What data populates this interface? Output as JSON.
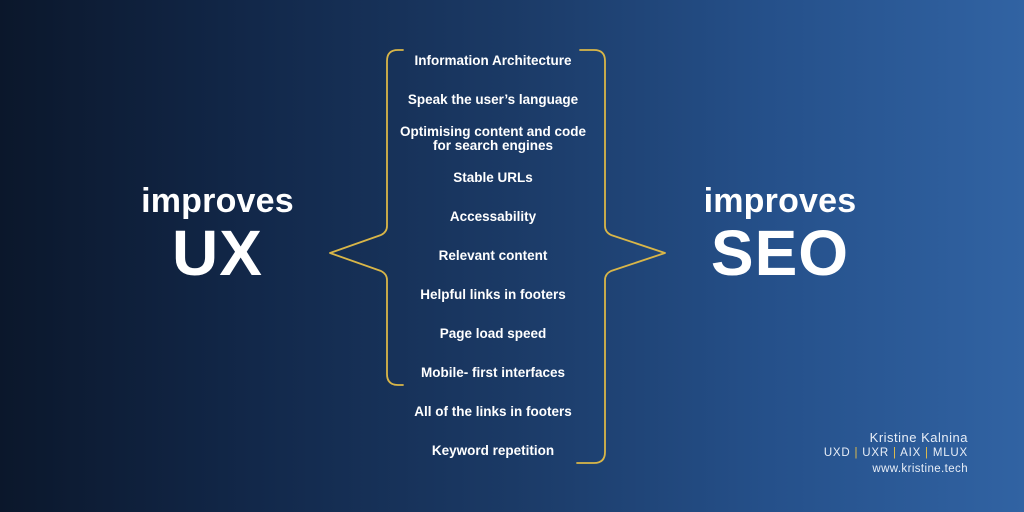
{
  "left": {
    "prefix": "improves",
    "topic": "UX"
  },
  "right": {
    "prefix": "improves",
    "topic": "SEO"
  },
  "items": [
    {
      "label": "Information Architecture",
      "ux": true,
      "seo": true
    },
    {
      "label": "Speak the user’s language",
      "ux": true,
      "seo": true
    },
    {
      "label": "Optimising content and code\nfor search engines",
      "ux": true,
      "seo": true
    },
    {
      "label": "Stable URLs",
      "ux": true,
      "seo": true
    },
    {
      "label": "Accessability",
      "ux": true,
      "seo": true
    },
    {
      "label": "Relevant content",
      "ux": true,
      "seo": true
    },
    {
      "label": "Helpful links in footers",
      "ux": true,
      "seo": true
    },
    {
      "label": "Page load speed",
      "ux": true,
      "seo": true
    },
    {
      "label": "Mobile- first interfaces",
      "ux": true,
      "seo": true
    },
    {
      "label": "All of the links in footers",
      "ux": false,
      "seo": true
    },
    {
      "label": "Keyword repetition",
      "ux": false,
      "seo": true
    }
  ],
  "credit": {
    "name": "Kristine Kalnina",
    "roles": [
      "UXD",
      "UXR",
      "AIX",
      "MLUX"
    ],
    "url": "www.kristine.tech"
  },
  "colors": {
    "brace": "#d9b648",
    "separator": "#e6c04a",
    "text": "#ffffff"
  }
}
